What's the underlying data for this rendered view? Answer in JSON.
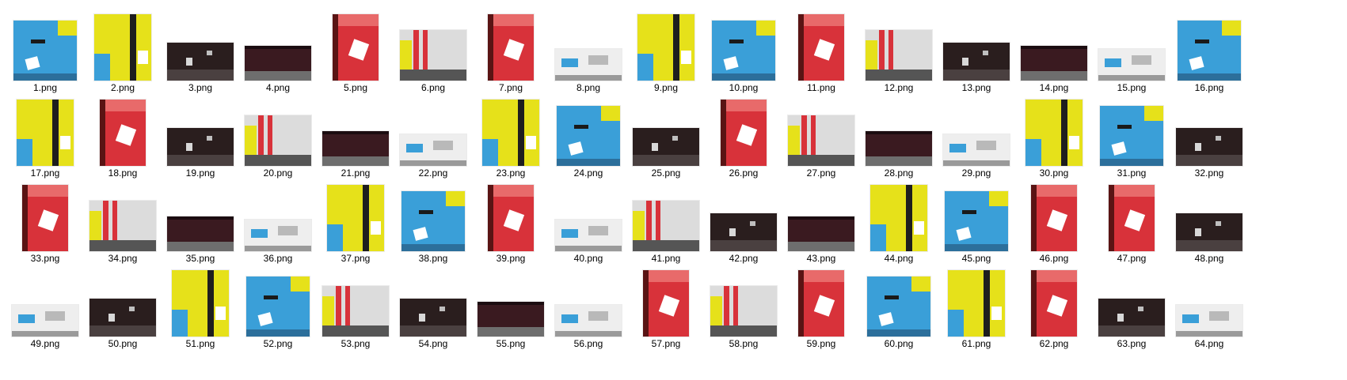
{
  "files": [
    {
      "name": "1.png",
      "kind": "blue-case"
    },
    {
      "name": "2.png",
      "kind": "yellow-case"
    },
    {
      "name": "3.png",
      "kind": "dark-belt"
    },
    {
      "name": "4.png",
      "kind": "dark-box"
    },
    {
      "name": "5.png",
      "kind": "red-case"
    },
    {
      "name": "6.png",
      "kind": "silver-strap"
    },
    {
      "name": "7.png",
      "kind": "red-case"
    },
    {
      "name": "8.png",
      "kind": "white-pile"
    },
    {
      "name": "9.png",
      "kind": "yellow-case"
    },
    {
      "name": "10.png",
      "kind": "blue-case"
    },
    {
      "name": "11.png",
      "kind": "red-case"
    },
    {
      "name": "12.png",
      "kind": "silver-strap"
    },
    {
      "name": "13.png",
      "kind": "dark-belt"
    },
    {
      "name": "14.png",
      "kind": "dark-box"
    },
    {
      "name": "15.png",
      "kind": "white-pile"
    },
    {
      "name": "16.png",
      "kind": "blue-case"
    },
    {
      "name": "17.png",
      "kind": "yellow-case"
    },
    {
      "name": "18.png",
      "kind": "red-case"
    },
    {
      "name": "19.png",
      "kind": "dark-belt"
    },
    {
      "name": "20.png",
      "kind": "silver-strap"
    },
    {
      "name": "21.png",
      "kind": "dark-box"
    },
    {
      "name": "22.png",
      "kind": "white-pile"
    },
    {
      "name": "23.png",
      "kind": "yellow-case"
    },
    {
      "name": "24.png",
      "kind": "blue-case"
    },
    {
      "name": "25.png",
      "kind": "dark-belt"
    },
    {
      "name": "26.png",
      "kind": "red-case"
    },
    {
      "name": "27.png",
      "kind": "silver-strap"
    },
    {
      "name": "28.png",
      "kind": "dark-box"
    },
    {
      "name": "29.png",
      "kind": "white-pile"
    },
    {
      "name": "30.png",
      "kind": "yellow-case"
    },
    {
      "name": "31.png",
      "kind": "blue-case"
    },
    {
      "name": "32.png",
      "kind": "dark-belt"
    },
    {
      "name": "33.png",
      "kind": "red-case"
    },
    {
      "name": "34.png",
      "kind": "silver-strap"
    },
    {
      "name": "35.png",
      "kind": "dark-box"
    },
    {
      "name": "36.png",
      "kind": "white-pile"
    },
    {
      "name": "37.png",
      "kind": "yellow-case"
    },
    {
      "name": "38.png",
      "kind": "blue-case"
    },
    {
      "name": "39.png",
      "kind": "red-case"
    },
    {
      "name": "40.png",
      "kind": "white-pile"
    },
    {
      "name": "41.png",
      "kind": "silver-strap"
    },
    {
      "name": "42.png",
      "kind": "dark-belt"
    },
    {
      "name": "43.png",
      "kind": "dark-box"
    },
    {
      "name": "44.png",
      "kind": "yellow-case"
    },
    {
      "name": "45.png",
      "kind": "blue-case"
    },
    {
      "name": "46.png",
      "kind": "red-case"
    },
    {
      "name": "47.png",
      "kind": "red-case"
    },
    {
      "name": "48.png",
      "kind": "dark-belt"
    },
    {
      "name": "49.png",
      "kind": "white-pile"
    },
    {
      "name": "50.png",
      "kind": "dark-belt"
    },
    {
      "name": "51.png",
      "kind": "yellow-case"
    },
    {
      "name": "52.png",
      "kind": "blue-case"
    },
    {
      "name": "53.png",
      "kind": "silver-strap"
    },
    {
      "name": "54.png",
      "kind": "dark-belt"
    },
    {
      "name": "55.png",
      "kind": "dark-box"
    },
    {
      "name": "56.png",
      "kind": "white-pile"
    },
    {
      "name": "57.png",
      "kind": "red-case"
    },
    {
      "name": "58.png",
      "kind": "silver-strap"
    },
    {
      "name": "59.png",
      "kind": "red-case"
    },
    {
      "name": "60.png",
      "kind": "blue-case"
    },
    {
      "name": "61.png",
      "kind": "yellow-case"
    },
    {
      "name": "62.png",
      "kind": "red-case"
    },
    {
      "name": "63.png",
      "kind": "dark-belt"
    },
    {
      "name": "64.png",
      "kind": "white-pile"
    }
  ],
  "palette": {
    "blue": "#3a9fd8",
    "yellow": "#e6e11a",
    "red": "#d8323a",
    "dark": "#2a1e1e",
    "silver": "#dcdcdc",
    "white": "#eeeeee"
  }
}
